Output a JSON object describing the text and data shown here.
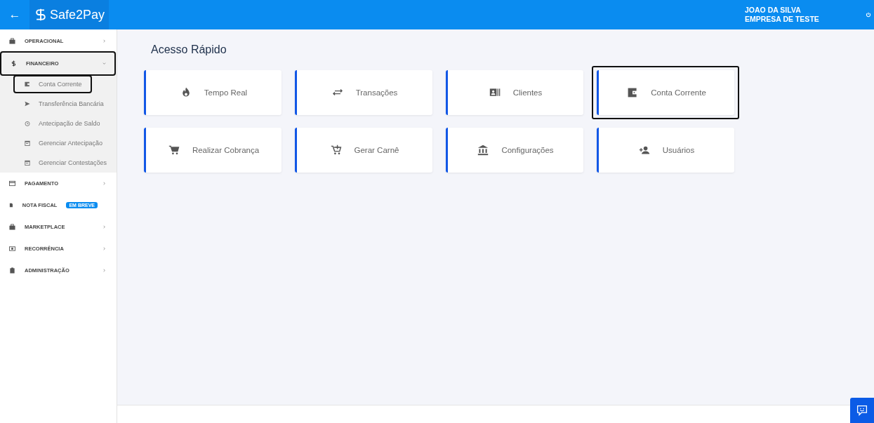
{
  "header": {
    "back": "←",
    "logo": "Safe2Pay",
    "user": "JOAO DA SILVA",
    "company": "EMPRESA DE TESTE"
  },
  "sidebar": {
    "items": [
      {
        "label": "OPERACIONAL",
        "expanded": false,
        "highlighted": false
      },
      {
        "label": "FINANCEIRO",
        "expanded": true,
        "highlighted": true,
        "children": [
          {
            "label": "Conta Corrente",
            "highlighted": true
          },
          {
            "label": "Transferência Bancária",
            "highlighted": false
          },
          {
            "label": "Antecipação de Saldo",
            "highlighted": false
          },
          {
            "label": "Gerenciar Antecipação",
            "highlighted": false
          },
          {
            "label": "Gerenciar Contestações",
            "highlighted": false
          }
        ]
      },
      {
        "label": "PAGAMENTO",
        "expanded": false,
        "highlighted": false
      },
      {
        "label": "NOTA FISCAL",
        "badge": "EM BREVE",
        "highlighted": false
      },
      {
        "label": "MARKETPLACE",
        "expanded": false,
        "highlighted": false
      },
      {
        "label": "RECORRÊNCIA",
        "expanded": false,
        "highlighted": false
      },
      {
        "label": "ADMINISTRAÇÃO",
        "expanded": false,
        "highlighted": false
      }
    ]
  },
  "main": {
    "title": "Acesso Rápido",
    "tiles": [
      {
        "label": "Tempo Real",
        "highlighted": false
      },
      {
        "label": "Transações",
        "highlighted": false
      },
      {
        "label": "Clientes",
        "highlighted": false
      },
      {
        "label": "Conta Corrente",
        "highlighted": true
      },
      {
        "label": "Realizar Cobrança",
        "highlighted": false
      },
      {
        "label": "Gerar Carnê",
        "highlighted": false
      },
      {
        "label": "Configurações",
        "highlighted": false
      },
      {
        "label": "Usuários",
        "highlighted": false
      }
    ]
  }
}
